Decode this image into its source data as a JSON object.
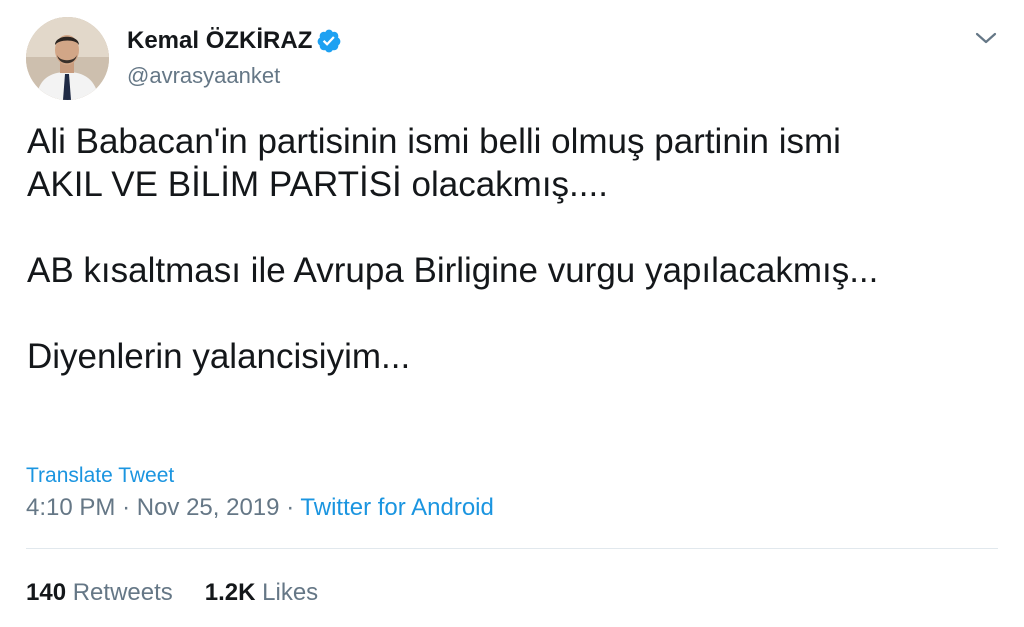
{
  "author": {
    "display_name": "Kemal ÖZKİRAZ",
    "handle": "@avrasyaanket",
    "verified_icon": "verified-badge-icon",
    "avatar": "profile-photo"
  },
  "tweet": {
    "lines": [
      "Ali Babacan'in partisinin ismi belli olmuş partinin ismi",
      "AKIL VE BİLİM PARTİSİ olacakmış....",
      "AB kısaltması ile Avrupa Birligine vurgu yapılacakmış...",
      "Diyenlerin yalancisiyim..."
    ],
    "translate_label": "Translate Tweet",
    "time": "4:10 PM",
    "separator": "·",
    "date": "Nov 25, 2019",
    "source": "Twitter for Android"
  },
  "stats": {
    "retweets_count": "140",
    "retweets_label": "Retweets",
    "likes_count": "1.2K",
    "likes_label": "Likes"
  },
  "colors": {
    "link": "#1b95e0",
    "secondary_text": "#657786",
    "primary_text": "#14171a",
    "verified": "#1da1f2"
  },
  "icons": {
    "menu": "chevron-down-icon"
  }
}
